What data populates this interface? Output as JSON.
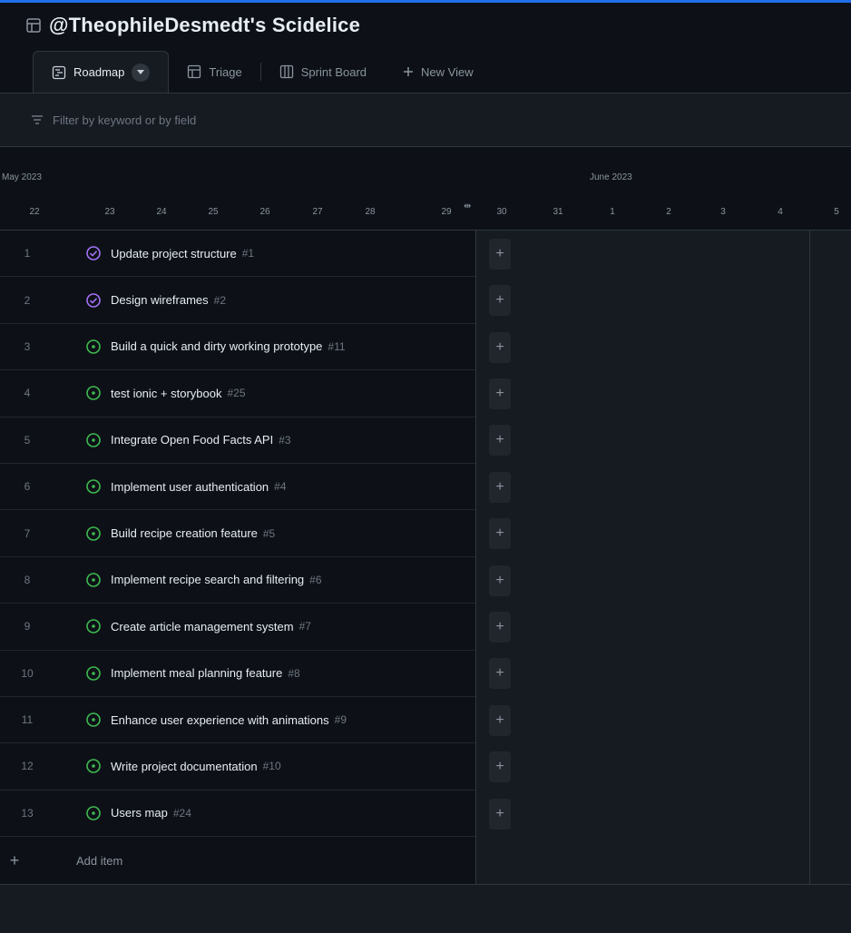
{
  "header": {
    "title": "@TheophileDesmedt's Scidelice"
  },
  "tabs": [
    {
      "label": "Roadmap",
      "icon": "roadmap-icon",
      "active": true
    },
    {
      "label": "Triage",
      "icon": "table-icon",
      "active": false
    },
    {
      "label": "Sprint Board",
      "icon": "board-icon",
      "active": false
    },
    {
      "label": "New View",
      "icon": "plus-icon",
      "active": false
    }
  ],
  "filter": {
    "placeholder": "Filter by keyword or by field"
  },
  "timeline": {
    "months": [
      "May 2023",
      "June 2023"
    ],
    "days": [
      "22",
      "23",
      "24",
      "25",
      "26",
      "27",
      "28",
      "29",
      "30",
      "31",
      "1",
      "2",
      "3",
      "4",
      "5"
    ]
  },
  "rows": [
    {
      "num": "1",
      "title": "Update project structure",
      "ref": "#1",
      "status": "done"
    },
    {
      "num": "2",
      "title": "Design wireframes",
      "ref": "#2",
      "status": "done"
    },
    {
      "num": "3",
      "title": "Build a quick and dirty working prototype",
      "ref": "#11",
      "status": "open"
    },
    {
      "num": "4",
      "title": "test ionic + storybook",
      "ref": "#25",
      "status": "open"
    },
    {
      "num": "5",
      "title": "Integrate Open Food Facts API",
      "ref": "#3",
      "status": "open"
    },
    {
      "num": "6",
      "title": "Implement user authentication",
      "ref": "#4",
      "status": "open"
    },
    {
      "num": "7",
      "title": "Build recipe creation feature",
      "ref": "#5",
      "status": "open"
    },
    {
      "num": "8",
      "title": "Implement recipe search and filtering",
      "ref": "#6",
      "status": "open"
    },
    {
      "num": "9",
      "title": "Create article management system",
      "ref": "#7",
      "status": "open"
    },
    {
      "num": "10",
      "title": "Implement meal planning feature",
      "ref": "#8",
      "status": "open"
    },
    {
      "num": "11",
      "title": "Enhance user experience with animations",
      "ref": "#9",
      "status": "open"
    },
    {
      "num": "12",
      "title": "Write project documentation",
      "ref": "#10",
      "status": "open"
    },
    {
      "num": "13",
      "title": "Users map",
      "ref": "#24",
      "status": "open"
    }
  ],
  "add_item": {
    "label": "Add item"
  },
  "colors": {
    "done": "#a371f7",
    "open": "#3fb950",
    "accent": "#1f6feb"
  }
}
